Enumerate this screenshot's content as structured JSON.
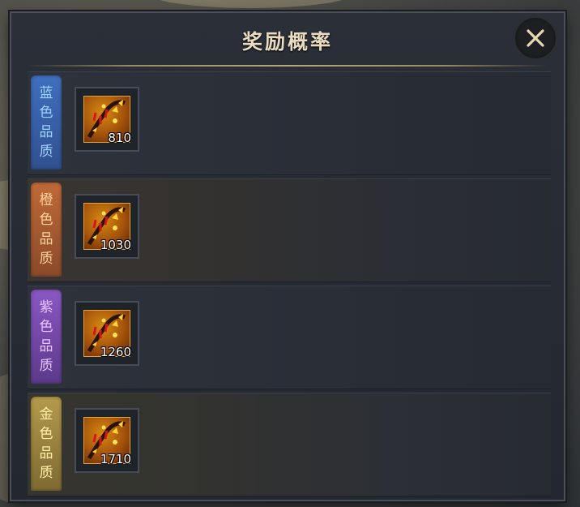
{
  "dialog": {
    "title": "奖励概率",
    "close_icon": "close-icon"
  },
  "rows": [
    {
      "tier": "blue",
      "label_chars": [
        "蓝",
        "色",
        "品",
        "质"
      ],
      "item_icon": "flame-scroll-icon",
      "count": "810",
      "color": "#3f6fc0"
    },
    {
      "tier": "orange",
      "label_chars": [
        "橙",
        "色",
        "品",
        "质"
      ],
      "item_icon": "flame-scroll-icon",
      "count": "1030",
      "color": "#c06a38"
    },
    {
      "tier": "purple",
      "label_chars": [
        "紫",
        "色",
        "品",
        "质"
      ],
      "item_icon": "flame-scroll-icon",
      "count": "1260",
      "color": "#8a57c4"
    },
    {
      "tier": "gold",
      "label_chars": [
        "金",
        "色",
        "品",
        "质"
      ],
      "item_icon": "flame-scroll-icon",
      "count": "1710",
      "color": "#b49a4c"
    }
  ]
}
